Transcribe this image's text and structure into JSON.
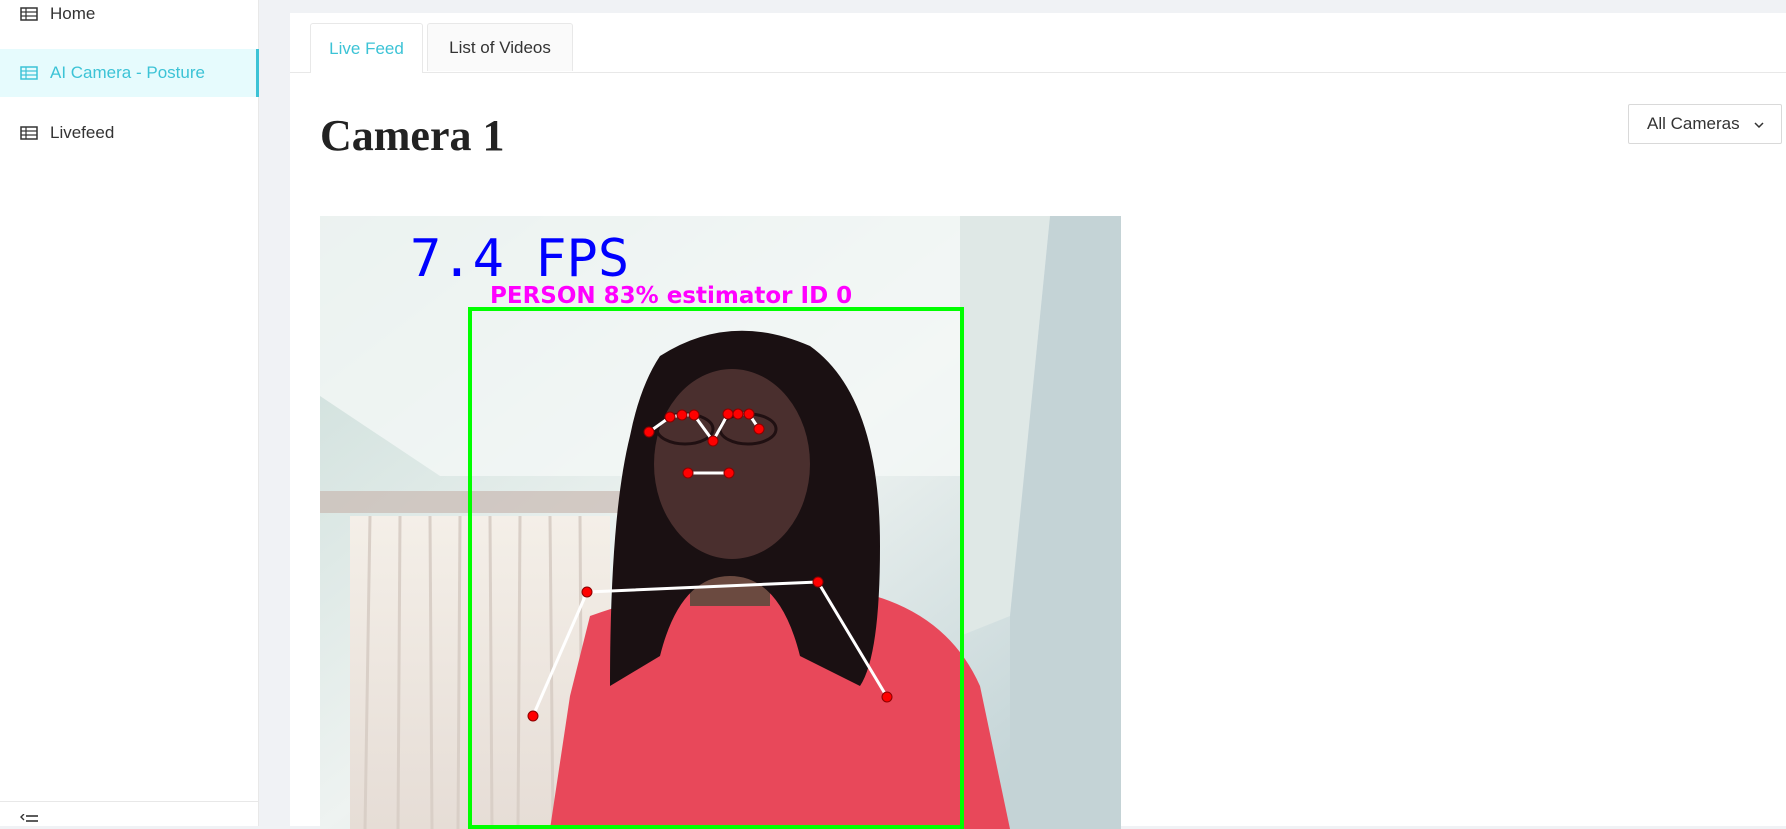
{
  "sidebar": {
    "items": [
      {
        "label": "Home",
        "icon": "table-icon",
        "active": false
      },
      {
        "label": "AI Camera - Posture",
        "icon": "table-icon",
        "active": true
      },
      {
        "label": "Livefeed",
        "icon": "table-icon",
        "active": false
      }
    ],
    "footer_icon": "menu-collapse-icon"
  },
  "tabs": [
    {
      "label": "Live Feed",
      "active": true
    },
    {
      "label": "List of Videos",
      "active": false
    }
  ],
  "page_title": "Camera 1",
  "camera_select": {
    "selected": "All Cameras",
    "icon": "chevron-down-icon"
  },
  "feed": {
    "fps_text": "7.4 FPS",
    "detection_label": "PERSON 83% estimator ID 0",
    "colors": {
      "fps": "#0000ff",
      "label": "#ff00ff",
      "box": "#00ff00",
      "keypoint": "#ff0000",
      "skeleton": "#ffffff"
    }
  },
  "colors": {
    "accent": "#3cc3d6",
    "active_bg": "#e6fbfd",
    "page_bg": "#f0f2f5"
  }
}
